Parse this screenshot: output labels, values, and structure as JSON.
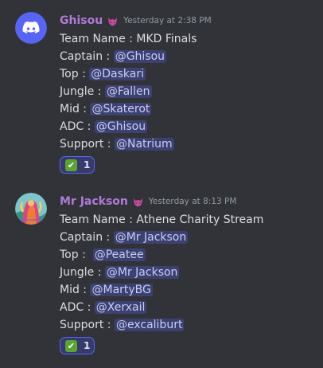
{
  "messages": [
    {
      "author": "Ghisou",
      "timestamp": "Yesterday at 2:38 PM",
      "lines": [
        {
          "label": "Team Name : MKD Finals"
        },
        {
          "label": "Captain : ",
          "mention": "@Ghisou"
        },
        {
          "label": "Top : ",
          "mention": "@Daskari"
        },
        {
          "label": "Jungle : ",
          "mention": "@Fallen"
        },
        {
          "label": "Mid : ",
          "mention": "@Skaterot"
        },
        {
          "label": "ADC : ",
          "mention": "@Ghisou"
        },
        {
          "label": "Support : ",
          "mention": "@Natrium"
        }
      ],
      "reaction": {
        "emoji": "✔",
        "count": "1"
      }
    },
    {
      "author": "Mr Jackson",
      "timestamp": "Yesterday at 8:13 PM",
      "lines": [
        {
          "label": "Team Name : Athene Charity Stream"
        },
        {
          "label": "Captain : ",
          "mention": "@Mr Jackson"
        },
        {
          "label": "Top :  ",
          "mention": "@Peatee"
        },
        {
          "label": "Jungle : ",
          "mention": "@Mr Jackson"
        },
        {
          "label": "Mid : ",
          "mention": "@MartyBG"
        },
        {
          "label": "ADC : ",
          "mention": "@Xerxail"
        },
        {
          "label": "Support : ",
          "mention": "@excaliburt"
        }
      ],
      "reaction": {
        "emoji": "✔",
        "count": "1"
      }
    }
  ],
  "colors": {
    "background": "#313338",
    "username": "#b07ad6",
    "mention_bg": "#3c4270",
    "mention_text": "#c9cdfb",
    "reaction_border": "#5865f2",
    "discord_blurple": "#5865f2"
  },
  "icons": {
    "avatar_1": "discord-logo-icon",
    "avatar_2": "painted-figure-avatar",
    "role": "demon-mask-icon",
    "reaction": "check-mark-button-emoji"
  }
}
